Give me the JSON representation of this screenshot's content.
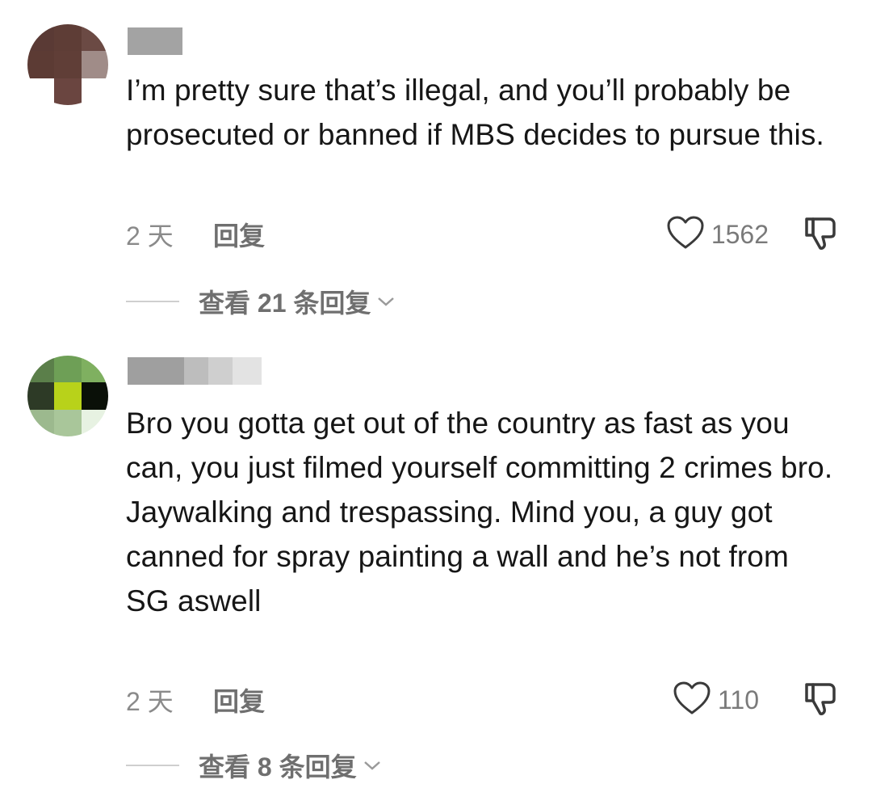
{
  "comments": [
    {
      "text": "I’m pretty sure that’s illegal, and you’ll probably be prosecuted or banned if MBS decides to pursue this.",
      "time": "2 天",
      "reply_label": "回复",
      "like_count": "1562",
      "view_replies": "查看 21 条回复",
      "avatar_icon": "blurred-avatar",
      "username_state": "blurred"
    },
    {
      "text": "Bro you gotta get out of the country as fast as you can, you just filmed yourself committing 2 crimes bro. Jaywalking and trespassing. Mind you, a guy got canned for spray painting a wall and he’s not from SG aswell",
      "time": "2 天",
      "reply_label": "回复",
      "like_count": "110",
      "view_replies": "查看 8 条回复",
      "avatar_icon": "blurred-avatar",
      "username_state": "blurred"
    }
  ],
  "icons": {
    "like": "heart-outline-icon",
    "dislike": "thumbs-down-icon",
    "expand": "chevron-down-icon"
  },
  "colors": {
    "text": "#161616",
    "muted": "#8a8a8a",
    "icon": "#3a3a3a"
  }
}
